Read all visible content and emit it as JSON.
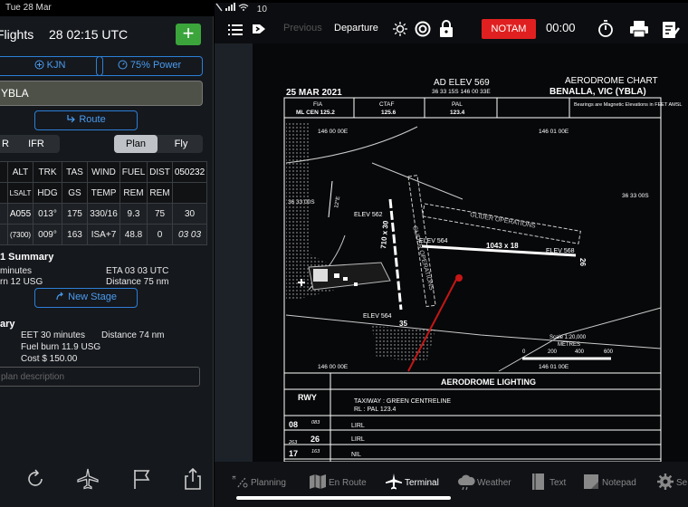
{
  "status": {
    "date": "Tue 28 Mar",
    "battery": "10"
  },
  "left": {
    "title": "Flights",
    "datetime": "28 02:15 UTC",
    "add_label": "+",
    "aircraft_btn": "KJN",
    "power_btn": "75% Power",
    "airport": "YBLA",
    "route_btn": "Route",
    "rules_left": "R",
    "rules_right": "IFR",
    "mode_plan": "Plan",
    "mode_fly": "Fly",
    "table": {
      "header1": [
        "",
        "ALT",
        "TRK",
        "TAS",
        "WIND",
        "FUEL",
        "DIST",
        "050232"
      ],
      "header2": [
        "",
        "LSALT",
        "HDG",
        "GS",
        "TEMP",
        "REM",
        "REM",
        ""
      ],
      "row1": [
        "",
        "A055",
        "013°",
        "175",
        "330/16",
        "9.3",
        "75",
        "30"
      ],
      "row2": [
        "",
        "(7300)",
        "009°",
        "163",
        "ISA+7",
        "48.8",
        "0",
        "03 03"
      ]
    },
    "summary_title": "1 Summary",
    "summary": {
      "minutes": "minutes",
      "eta": "ETA 03 03 UTC",
      "burn": "rn 12 USG",
      "distance": "Distance 75 nm"
    },
    "new_stage_btn": "New Stage",
    "overall_title": "ary",
    "overall": {
      "eet": "EET 30 minutes",
      "distance": "Distance 74 nm",
      "fuel": "Fuel burn 11.9 USG",
      "cost": "Cost $ 150.00"
    },
    "desc_placeholder": "plan description"
  },
  "right": {
    "previous": "Previous",
    "departure": "Departure",
    "notam": "NOTAM",
    "timer": "00:00",
    "tabs": [
      "Planning",
      "En Route",
      "Terminal",
      "Weather",
      "Text",
      "Notepad",
      "Se"
    ]
  },
  "chart": {
    "date": "25 MAR 2021",
    "ad_elev": "AD ELEV 569",
    "coords": "36 33 15S 146 00 33E",
    "title": "AERODROME CHART",
    "location": "BENALLA, VIC (YBLA)",
    "freq_labels": [
      "FIA",
      "CTAF",
      "PAL"
    ],
    "freq_values": [
      "ML CEN 125.2",
      "125.6",
      "123.4"
    ],
    "bearing_note": "Bearings are Magnetic Elevations in FEET AMSL",
    "lon_left": "146 00 00E",
    "lon_right": "146 01 00E",
    "lat_label": "36 33 00S",
    "elev_562": "ELEV 562",
    "elev_564a": "ELEV 564",
    "elev_564b": "ELEV 564",
    "elev_568": "ELEV 568",
    "glider_ops": "GLIDER OPERATIONS",
    "rwy_main": "1043 x 18",
    "rwy_cross": "710 x 30",
    "rwy_num_35": "35",
    "rwy_num_26": "26",
    "scale": "Scale 1:20,000",
    "metres": "METRES",
    "scale_ticks": [
      "0",
      "200",
      "400",
      "600"
    ],
    "mag_var": "12°E",
    "lighting_title": "AERODROME LIGHTING",
    "rwy_header": "RWY",
    "taxiway": "TAXIWAY : GREEN CENTRELINE",
    "rl": "RL         : PAL 123.4",
    "rows": [
      {
        "rwy": "08",
        "hdg": "083",
        "val": "LIRL"
      },
      {
        "rwy": "26",
        "hdg": "263",
        "val": "LIRL"
      },
      {
        "rwy": "17",
        "hdg": "163",
        "val": "NIL"
      }
    ]
  }
}
